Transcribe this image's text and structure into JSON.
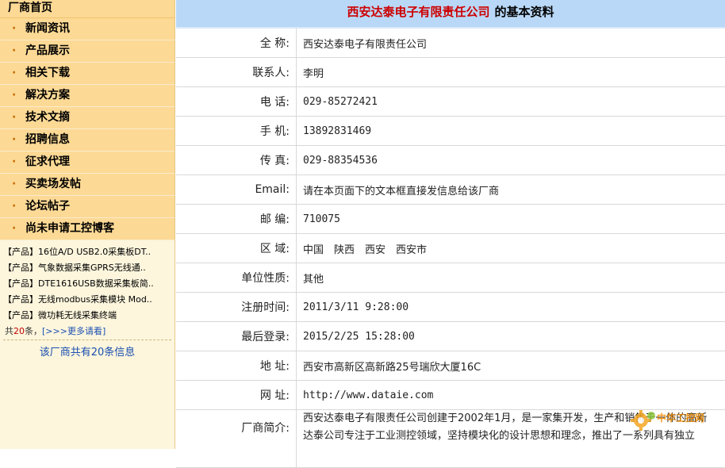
{
  "sidebar": {
    "home": "厂商首页",
    "menu": [
      "新闻资讯",
      "产品展示",
      "相关下载",
      "解决方案",
      "技术文摘",
      "招聘信息",
      "征求代理",
      "买卖场发帖",
      "论坛帖子",
      "尚未申请工控博客"
    ],
    "products": [
      {
        "tag": "【产品】",
        "name": "16位A/D USB2.0采集板DT.."
      },
      {
        "tag": "【产品】",
        "name": "气象数据采集GPRS无线通.."
      },
      {
        "tag": "【产品】",
        "name": "DTE1616USB数据采集板简.."
      },
      {
        "tag": "【产品】",
        "name": "无线modbus采集模块 Mod.."
      },
      {
        "tag": "【产品】",
        "name": "微功耗无线采集终端"
      }
    ],
    "count_prefix": "共",
    "count_number": "20",
    "count_suffix": "条，",
    "more_link": "[>>>更多请看]",
    "total_info": "该厂商共有20条信息"
  },
  "main": {
    "title_company": "西安达泰电子有限责任公司",
    "title_suffix": "的基本资料",
    "rows": [
      {
        "label": "全 称:",
        "value": "西安达泰电子有限责任公司"
      },
      {
        "label": "联系人:",
        "value": "李明"
      },
      {
        "label": "电 话:",
        "value": "029-85272421"
      },
      {
        "label": "手 机:",
        "value": "13892831469"
      },
      {
        "label": "传 真:",
        "value": "029-88354536"
      },
      {
        "label": "Email:",
        "value": "请在本页面下的文本框直接发信息给该厂商"
      },
      {
        "label": "邮 编:",
        "value": "710075"
      },
      {
        "label": "区 域:",
        "value": "中国　陕西　西安　西安市"
      },
      {
        "label": "单位性质:",
        "value": "其他"
      },
      {
        "label": "注册时间:",
        "value": "2011/3/11 9:28:00"
      },
      {
        "label": "最后登录:",
        "value": "2015/2/25 15:28:00"
      },
      {
        "label": "地 址:",
        "value": "西安市高新区高新路25号瑞欣大厦16C"
      },
      {
        "label": "网 址:",
        "value": "http://www.dataie.com"
      }
    ],
    "intro_label": "厂商简介:",
    "intro_line1": "西安达泰电子有限责任公司创建于2002年1月，是一家集开发，生产和销售于一体的高新",
    "intro_line2": "达泰公司专注于工业测控领域，坚持模块化的设计思想和理念，推出了一系列具有独立"
  },
  "watermark": {
    "text": "中华工控网",
    "color": "#f08a00"
  }
}
